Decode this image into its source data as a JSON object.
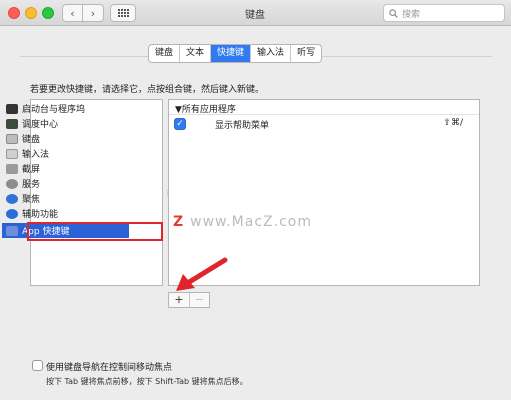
{
  "window": {
    "title": "键盘",
    "search_placeholder": "搜索",
    "back_glyph": "‹",
    "forward_glyph": "›"
  },
  "tabs": [
    {
      "label": "键盘",
      "active": false
    },
    {
      "label": "文本",
      "active": false
    },
    {
      "label": "快捷键",
      "active": true
    },
    {
      "label": "输入法",
      "active": false
    },
    {
      "label": "听写",
      "active": false
    }
  ],
  "instruction": "若要更改快捷键，请选择它，点按组合键，然后键入新键。",
  "categories": [
    {
      "label": "启动台与程序坞",
      "icon": "launchpad-icon"
    },
    {
      "label": "调度中心",
      "icon": "mission-control-icon"
    },
    {
      "label": "键盘",
      "icon": "keyboard-icon"
    },
    {
      "label": "输入法",
      "icon": "input-source-icon"
    },
    {
      "label": "截屏",
      "icon": "screenshot-icon"
    },
    {
      "label": "服务",
      "icon": "gear-icon"
    },
    {
      "label": "聚焦",
      "icon": "spotlight-icon"
    },
    {
      "label": "辅助功能",
      "icon": "accessibility-icon"
    },
    {
      "label": "App 快捷键",
      "icon": "app-shortcuts-icon",
      "selected": true
    }
  ],
  "shortcuts": {
    "group_header": "▼所有应用程序",
    "rows": [
      {
        "checked": true,
        "name": "显示帮助菜单",
        "keys": "⇧⌘/"
      }
    ]
  },
  "watermark": {
    "logo": "Z",
    "text": "www.MacZ.com"
  },
  "buttons": {
    "add": "+",
    "remove": "−"
  },
  "footer": {
    "nav_checkbox_label": "使用键盘导航在控制间移动焦点",
    "nav_hint": "按下 Tab 键将焦点前移，按下 Shift-Tab 键将焦点后移。"
  },
  "colors": {
    "accent": "#2f7bef",
    "selection": "#2b62d6",
    "highlight_outline": "#e0242b",
    "arrow": "#e0242b"
  }
}
